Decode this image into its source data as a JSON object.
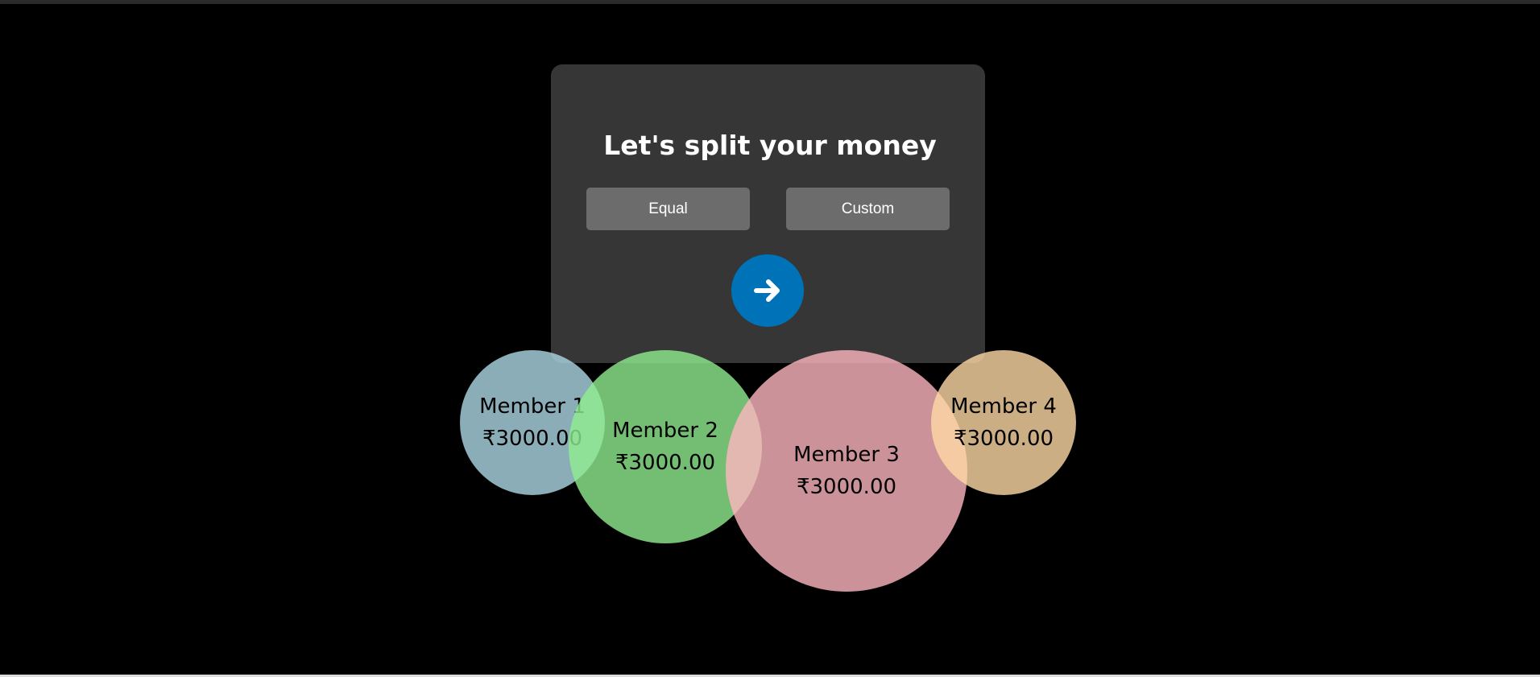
{
  "title": "Let's split your money",
  "split_options": {
    "equal_label": "Equal",
    "custom_label": "Custom"
  },
  "next_button": {
    "icon": "arrow-right-icon",
    "color": "#0073b8"
  },
  "members": [
    {
      "name": "Member 1",
      "amount": "₹3000.00",
      "color": "#add8e6"
    },
    {
      "name": "Member 2",
      "amount": "₹3000.00",
      "color": "#90ee90"
    },
    {
      "name": "Member 3",
      "amount": "₹3000.00",
      "color": "#ffb6c1"
    },
    {
      "name": "Member 4",
      "amount": "₹3000.00",
      "color": "#ffdaa5"
    }
  ]
}
